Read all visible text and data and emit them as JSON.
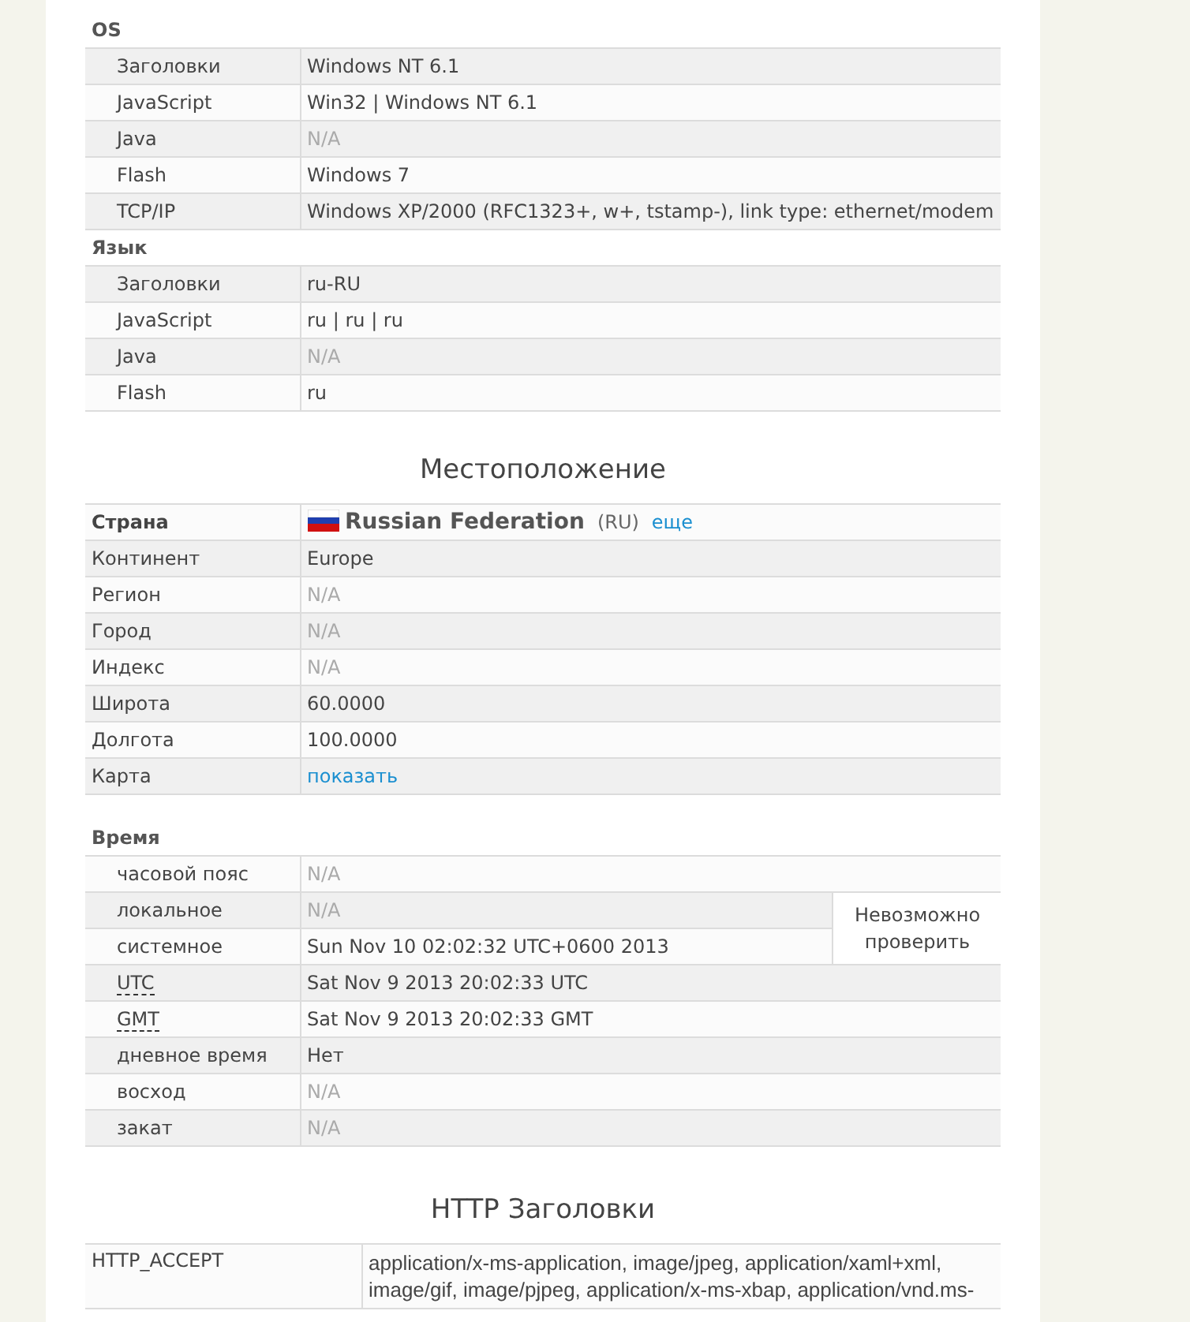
{
  "groups_top": [
    {
      "title": "OS",
      "rows": [
        {
          "label": "Заголовки",
          "kind": "text",
          "value": "Windows NT 6.1"
        },
        {
          "label": "JavaScript",
          "kind": "text",
          "value": "Win32 | Windows NT 6.1"
        },
        {
          "label": "Java",
          "kind": "na",
          "value": "N/A"
        },
        {
          "label": "Flash",
          "kind": "text",
          "value": "Windows 7"
        },
        {
          "label": "TCP/IP",
          "kind": "text",
          "value": "Windows XP/2000 (RFC1323+, w+, tstamp-), link type: ethernet/modem"
        }
      ]
    },
    {
      "title": "Язык",
      "rows": [
        {
          "label": "Заголовки",
          "kind": "text",
          "value": "ru-RU"
        },
        {
          "label": "JavaScript",
          "kind": "text",
          "value": "ru | ru | ru"
        },
        {
          "label": "Java",
          "kind": "na",
          "value": "N/A"
        },
        {
          "label": "Flash",
          "kind": "text",
          "value": "ru"
        }
      ]
    }
  ],
  "location": {
    "title": "Местоположение",
    "rows": [
      {
        "label": "Страна",
        "kind": "country",
        "name": "Russian Federation",
        "code": "(RU)",
        "link": "еще"
      },
      {
        "label": "Континент",
        "kind": "text",
        "value": "Europe"
      },
      {
        "label": "Регион",
        "kind": "na",
        "value": "N/A"
      },
      {
        "label": "Город",
        "kind": "na",
        "value": "N/A"
      },
      {
        "label": "Индекс",
        "kind": "na",
        "value": "N/A"
      },
      {
        "label": "Широта",
        "kind": "text",
        "value": "60.0000"
      },
      {
        "label": "Долгота",
        "kind": "text",
        "value": "100.0000"
      },
      {
        "label": "Карта",
        "kind": "link",
        "value": "показать"
      }
    ]
  },
  "time": {
    "title": "Время",
    "rows": [
      {
        "label": "часовой пояс",
        "abbr": false,
        "kind": "na",
        "value": "N/A"
      },
      {
        "label": "локальное",
        "abbr": false,
        "kind": "na",
        "value": "N/A",
        "note": "Невозможно проверить"
      },
      {
        "label": "системное",
        "abbr": false,
        "kind": "text",
        "value": "Sun Nov 10 02:02:32 UTC+0600 2013"
      },
      {
        "label": "UTC",
        "abbr": true,
        "kind": "text",
        "value": "Sat Nov 9 2013 20:02:33 UTC"
      },
      {
        "label": "GMT",
        "abbr": true,
        "kind": "text",
        "value": "Sat Nov 9 2013 20:02:33 GMT"
      },
      {
        "label": "дневное время",
        "abbr": false,
        "kind": "text",
        "value": "Нет"
      },
      {
        "label": "восход",
        "abbr": false,
        "kind": "na",
        "value": "N/A"
      },
      {
        "label": "закат",
        "abbr": false,
        "kind": "na",
        "value": "N/A"
      }
    ]
  },
  "http": {
    "title": "HTTP Заголовки",
    "rows": [
      {
        "label": "HTTP_ACCEPT",
        "lines": [
          "application/x-ms-application, image/jpeg, application/xaml+xml,",
          "image/gif, image/pjpeg, application/x-ms-xbap, application/vnd.ms-"
        ]
      }
    ]
  }
}
